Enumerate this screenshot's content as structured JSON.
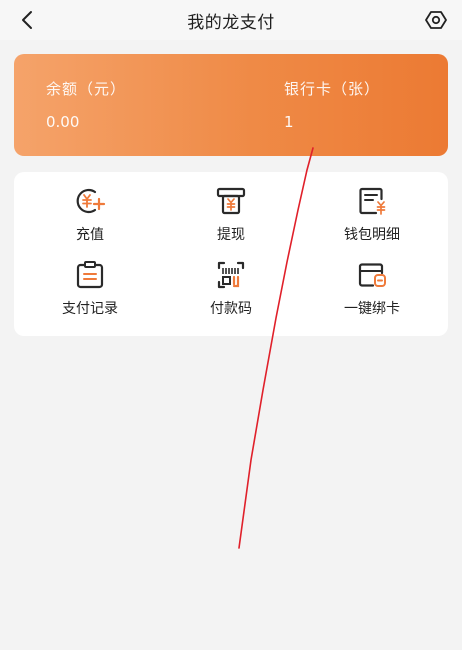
{
  "header": {
    "title": "我的龙支付",
    "back_icon": "chevron-left-icon",
    "settings_icon": "settings-icon"
  },
  "balance_card": {
    "balance_label": "余额（元）",
    "balance_value": "0.00",
    "bank_card_label": "银行卡（张）",
    "bank_card_value": "1"
  },
  "menu": {
    "items": [
      {
        "label": "充值",
        "icon": "recharge-icon"
      },
      {
        "label": "提现",
        "icon": "withdraw-icon"
      },
      {
        "label": "钱包明细",
        "icon": "wallet-detail-icon"
      },
      {
        "label": "支付记录",
        "icon": "payment-record-icon"
      },
      {
        "label": "付款码",
        "icon": "payment-code-icon"
      },
      {
        "label": "一键绑卡",
        "icon": "bind-card-icon"
      }
    ]
  },
  "colors": {
    "accent": "#ef8a46",
    "card_start": "#f5a36a",
    "card_end": "#ec7a33",
    "annotation": "#e0202a"
  }
}
